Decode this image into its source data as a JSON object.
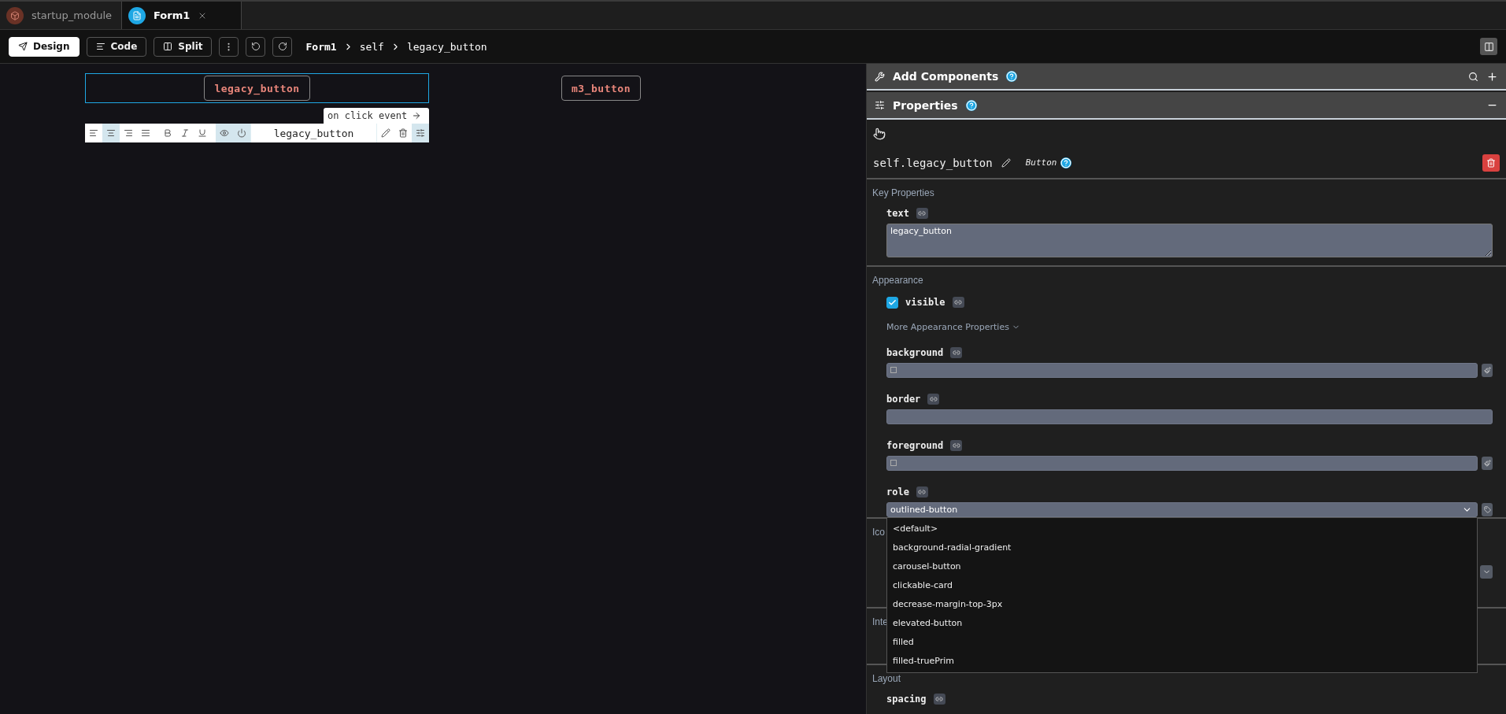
{
  "tabs": [
    {
      "label": "startup_module",
      "selected": false,
      "closable": false
    },
    {
      "label": "Form1",
      "selected": true,
      "closable": true
    }
  ],
  "toolbar": {
    "modes": [
      {
        "label": "Design",
        "selected": true
      },
      {
        "label": "Code",
        "selected": false
      },
      {
        "label": "Split",
        "selected": false
      }
    ],
    "breadcrumb": [
      "Form1",
      "self",
      "legacy_button"
    ]
  },
  "canvas": {
    "components": [
      {
        "label": "legacy_button",
        "selected": true
      },
      {
        "label": "m3_button",
        "selected": false
      }
    ],
    "event_hint": "on click event",
    "format_toolbar": {
      "tools": [
        {
          "kind": "align-left",
          "on": false
        },
        {
          "kind": "align-center",
          "on": true
        },
        {
          "kind": "align-right",
          "on": false
        },
        {
          "kind": "justify",
          "on": false
        },
        {
          "kind": "bold",
          "on": false
        },
        {
          "kind": "italic",
          "on": false
        },
        {
          "kind": "underline",
          "on": false
        },
        {
          "kind": "visible",
          "on": true
        },
        {
          "kind": "enabled",
          "on": true
        }
      ],
      "name": "legacy_button"
    }
  },
  "add_components": {
    "title": "Add Components"
  },
  "properties": {
    "title": "Properties",
    "expanded": true,
    "component": {
      "name": "self.legacy_button",
      "type": "Button"
    },
    "sections": [
      {
        "title": "Key Properties",
        "props": [
          {
            "kind": "textarea",
            "label": "text",
            "value": "legacy_button"
          }
        ]
      },
      {
        "title": "Appearance",
        "props": [
          {
            "kind": "checkbox",
            "label": "visible",
            "checked": true
          },
          {
            "kind": "more",
            "label": "More Appearance Properties"
          },
          {
            "kind": "color",
            "label": "background"
          },
          {
            "kind": "text",
            "label": "border"
          },
          {
            "kind": "color",
            "label": "foreground"
          },
          {
            "kind": "select",
            "label": "role",
            "value": "outlined-button",
            "expanded": true,
            "options": [
              "<default>",
              "background-radial-gradient",
              "carousel-button",
              "clickable-card",
              "decrease-margin-top-3px",
              "elevated-button",
              "filled",
              "filled-truePrim"
            ]
          }
        ]
      },
      {
        "title": "Ico",
        "props": [
          {
            "kind": "covered-select"
          }
        ]
      },
      {
        "title": "Inte"
      },
      {
        "title": "Layout",
        "props": [
          {
            "kind": "label",
            "label": "spacing"
          }
        ]
      }
    ]
  }
}
